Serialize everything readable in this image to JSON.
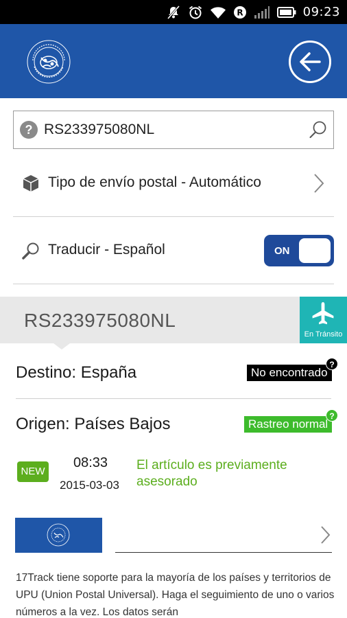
{
  "status_bar": {
    "time": "09:23"
  },
  "search": {
    "value": "RS233975080NL",
    "help_icon": "?"
  },
  "shipment_type": {
    "label": "Tipo de envío postal - Automático"
  },
  "translate": {
    "label": "Traducir - Español",
    "toggle_label": "ON"
  },
  "result": {
    "tracking_number": "RS233975080NL",
    "status_label": "En Tránsito",
    "destination": {
      "label": "Destino: España",
      "badge": "No encontrado",
      "help": "?"
    },
    "origin": {
      "label": "Origen: Países Bajos",
      "badge": "Rastreo normal",
      "help": "?"
    },
    "event": {
      "badge": "NEW",
      "time": "08:33",
      "date": "2015-03-03",
      "description": "El artículo es previamente asesorado"
    }
  },
  "description": "17Track tiene soporte para la mayoría de los países y territorios de UPU (Union Postal Universal). Haga el seguimiento de uno o varios números a la vez. Los datos serán",
  "colors": {
    "primary": "#1f56a8",
    "accent_teal": "#1fb5b5",
    "green": "#3dbb2c",
    "new_green": "#5cae1e"
  }
}
